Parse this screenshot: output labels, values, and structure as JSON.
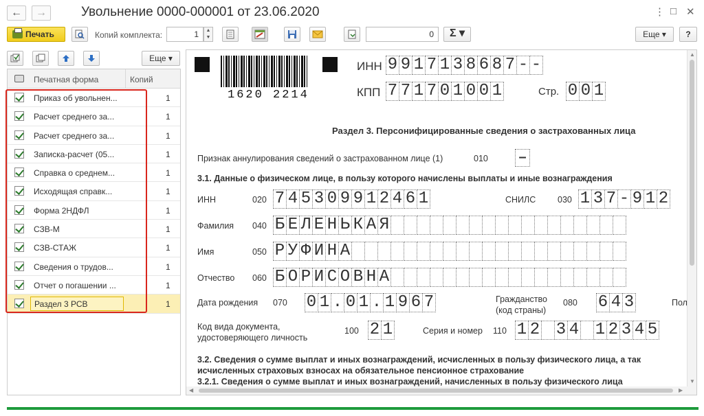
{
  "window": {
    "title": "Увольнение 0000-000001 от 23.06.2020",
    "back_icon": "←",
    "forward_icon": "→",
    "menu_icon": "⋮",
    "maximize_icon": "□",
    "close_icon": "✕"
  },
  "toolbar": {
    "print_label": "Печать",
    "copies_label": "Копий комплекта:",
    "copies_value": "1",
    "sum_value": "0",
    "sigma_label": "Σ ▾",
    "more_label": "Еще ▾",
    "help_label": "?"
  },
  "left_panel": {
    "more_label": "Еще ▾",
    "columns": {
      "name": "Печатная форма",
      "copies": "Копий"
    },
    "rows": [
      {
        "name": "Приказ об увольнен...",
        "copies": "1",
        "checked": true
      },
      {
        "name": "Расчет среднего за...",
        "copies": "1",
        "checked": true
      },
      {
        "name": "Расчет среднего за...",
        "copies": "1",
        "checked": true
      },
      {
        "name": "Записка-расчет (05...",
        "copies": "1",
        "checked": true
      },
      {
        "name": "Справка о среднем...",
        "copies": "1",
        "checked": true
      },
      {
        "name": "Исходящая справк...",
        "copies": "1",
        "checked": true
      },
      {
        "name": "Форма 2НДФЛ",
        "copies": "1",
        "checked": true
      },
      {
        "name": "СЗВ-М",
        "copies": "1",
        "checked": true
      },
      {
        "name": "СЗВ-СТАЖ",
        "copies": "1",
        "checked": true
      },
      {
        "name": "Сведения о трудов...",
        "copies": "1",
        "checked": true
      },
      {
        "name": "Отчет о погашении ...",
        "copies": "1",
        "checked": true
      },
      {
        "name": "Раздел 3 РСВ",
        "copies": "1",
        "checked": true,
        "selected": true
      }
    ]
  },
  "document": {
    "barcode_number": "1620 2214",
    "inn_label": "ИНН",
    "inn_digits": [
      "9",
      "9",
      "1",
      "7",
      "1",
      "3",
      "8",
      "6",
      "8",
      "7",
      "-",
      "-"
    ],
    "kpp_label": "КПП",
    "kpp_digits": [
      "7",
      "7",
      "1",
      "7",
      "0",
      "1",
      "0",
      "0",
      "1"
    ],
    "page_label": "Стр.",
    "page_digits": [
      "0",
      "0",
      "1"
    ],
    "section_title": "Раздел 3. Персонифицированные сведения о застрахованных лица",
    "annul_label": "Признак аннулирования сведений о застрахованном лице (1)",
    "annul_code": "010",
    "annul_value": "–",
    "sub31": "3.1. Данные о физическом лице, в пользу которого начислены выплаты и иные вознаграждения",
    "person_inn_label": "ИНН",
    "person_inn_code": "020",
    "person_inn_digits": [
      "7",
      "4",
      "5",
      "3",
      "0",
      "9",
      "9",
      "1",
      "2",
      "4",
      "6",
      "1"
    ],
    "snils_label": "СНИЛС",
    "snils_code": "030",
    "snils_digits": [
      "1",
      "3",
      "7",
      "-",
      "9",
      "1",
      "2"
    ],
    "surname_label": "Фамилия",
    "surname_code": "040",
    "surname_letters": [
      "Б",
      "Е",
      "Л",
      "Е",
      "Н",
      "Ь",
      "К",
      "А",
      "Я",
      "",
      "",
      "",
      "",
      "",
      "",
      "",
      "",
      "",
      "",
      "",
      "",
      "",
      "",
      "",
      "",
      "",
      ""
    ],
    "name_label": "Имя",
    "name_code": "050",
    "name_letters": [
      "Р",
      "У",
      "Ф",
      "И",
      "Н",
      "А",
      "",
      "",
      "",
      "",
      "",
      "",
      "",
      "",
      "",
      "",
      "",
      "",
      "",
      "",
      "",
      "",
      "",
      "",
      "",
      "",
      ""
    ],
    "patronymic_label": "Отчество",
    "patronymic_code": "060",
    "patronymic_letters": [
      "Б",
      "О",
      "Р",
      "И",
      "С",
      "О",
      "В",
      "Н",
      "А",
      "",
      "",
      "",
      "",
      "",
      "",
      "",
      "",
      "",
      "",
      "",
      "",
      "",
      "",
      "",
      "",
      "",
      ""
    ],
    "birth_label": "Дата рождения",
    "birth_code": "070",
    "birth_digits": [
      "0",
      "1",
      ".",
      "0",
      "1",
      ".",
      "1",
      "9",
      "6",
      "7"
    ],
    "citizenship_label_1": "Гражданство",
    "citizenship_label_2": "(код страны)",
    "citizenship_code": "080",
    "citizenship_digits": [
      "6",
      "4",
      "3"
    ],
    "gender_label": "Пол",
    "doc_type_label_1": "Код вида документа,",
    "doc_type_label_2": "удостоверяющего личность",
    "doc_type_code": "100",
    "doc_type_digits": [
      "2",
      "1"
    ],
    "series_label": "Серия и номер",
    "series_code": "110",
    "series_digits": [
      "1",
      "2",
      "",
      "3",
      "4",
      "",
      "1",
      "2",
      "3",
      "4",
      "5"
    ],
    "sub32_1": "3.2. Сведения о сумме выплат и иных вознаграждений, исчисленных в пользу физического лица, а так",
    "sub32_2": "исчисленных страховых взносах на обязательное пенсионное страхование",
    "sub321": "3.2.1. Сведения о сумме выплат и иных вознаграждений, начисленных в пользу физического лица"
  }
}
